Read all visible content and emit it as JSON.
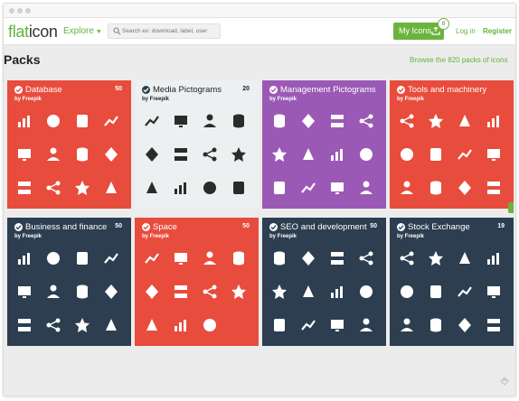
{
  "header": {
    "logo_prefix": "flat",
    "logo_suffix": "icon",
    "explore_label": "Explore",
    "search_placeholder": "Search ex: download, label, user",
    "my_icons_label": "My Icons",
    "my_icons_count": "0",
    "login_label": "Log in",
    "register_label": "Register"
  },
  "page": {
    "title": "Packs",
    "browse_link": "Browse the 820 packs of icons"
  },
  "colors": {
    "red": "#e84c3d",
    "light": "#ecf0f1",
    "purple": "#9b59b6",
    "navy": "#2c3e50",
    "green": "#62b33b"
  },
  "packs": [
    {
      "title": "Database",
      "count": "50",
      "author": "by Freepik",
      "theme": "red",
      "icons": [
        "bar-chart-icon",
        "network-users-icon",
        "globe-icon",
        "trend-line-icon",
        "chart-panel-icon",
        "hierarchy-icon",
        "database-cylinder-icon",
        "server-icon",
        "server-rack-icon",
        "share-nodes-icon",
        "server-stack-icon",
        "server-stack-alt-icon"
      ]
    },
    {
      "title": "Media Pictograms",
      "count": "20",
      "author": "by Freepik",
      "theme": "light",
      "icons": [
        "play-icon",
        "smartphone-icon",
        "newspaper-icon",
        "monitor-icon",
        "clapperboard-icon",
        "image-icon",
        "camera-icon",
        "vinyl-disc-icon",
        "video-camera-icon",
        "radio-icon",
        "world-icon",
        "headphones-icon"
      ]
    },
    {
      "title": "Management Pictograms",
      "count": "",
      "author": "by Freepik",
      "theme": "purple",
      "icons": [
        "user-network-icon",
        "manager-icon",
        "team-icon",
        "user-money-icon",
        "user-icon",
        "businessman-icon",
        "presentation-icon",
        "chat-users-icon",
        "user-award-icon",
        "trophy-user-icon",
        "users-gear-icon",
        "user-time-icon"
      ]
    },
    {
      "title": "Tools and machinery",
      "count": "",
      "author": "by Freepik",
      "theme": "red",
      "icons": [
        "blender-icon",
        "wheelbarrow-icon",
        "hammer-icon",
        "pliers-icon",
        "saw-icon",
        "spray-gun-icon",
        "wrench-icon",
        "screwdriver-icon",
        "toolbox-icon",
        "caulk-gun-icon",
        "paint-roller-icon",
        "lawn-mower-icon"
      ]
    },
    {
      "title": "Business and finance",
      "count": "50",
      "author": "by Freepik",
      "theme": "navy",
      "icons": [
        "coffee-cup-icon",
        "line-chart-icon",
        "dollar-coin-icon",
        "necktie-icon",
        "money-hand-icon",
        "chat-dollar-icon",
        "office-building-icon",
        "tablet-chart-icon",
        "location-pin-icon",
        "airplane-icon",
        "growth-chart-icon",
        "shield-dollar-icon"
      ]
    },
    {
      "title": "Space",
      "count": "50",
      "author": "by Freepik",
      "theme": "red",
      "icons": [
        "planet-earth-icon",
        "sun-ring-icon",
        "astronaut-icon",
        "moon-rover-icon",
        "ray-gun-icon",
        "space-rover-icon",
        "rocket-icon",
        "planet-icon",
        "saturn-icon",
        "asteroid-icon",
        "satellite-dish-icon",
        ""
      ]
    },
    {
      "title": "SEO and development",
      "count": "50",
      "author": "by Freepik",
      "theme": "navy",
      "icons": [
        "trophy-icon",
        "document-code-icon",
        "target-arrows-icon",
        "map-pin-icon",
        "browser-window-icon",
        "team-users-icon",
        "user-profile-icon",
        "settings-sliders-icon",
        "seo-tag-icon",
        "code-window-icon",
        "anchor-link-icon",
        "window-list-icon"
      ]
    },
    {
      "title": "Stock Exchange",
      "count": "19",
      "author": "by Freepik",
      "theme": "navy",
      "icons": [
        "credit-card-icon",
        "stopwatch-icon",
        "trophy-cup-icon",
        "coin-stack-icon",
        "safe-box-icon",
        "ticker-tape-icon",
        "buildings-icon",
        "pie-chart-icon",
        "bank-icon",
        "clipboard-icon",
        "calculator-icon",
        "handshake-icon"
      ]
    }
  ]
}
